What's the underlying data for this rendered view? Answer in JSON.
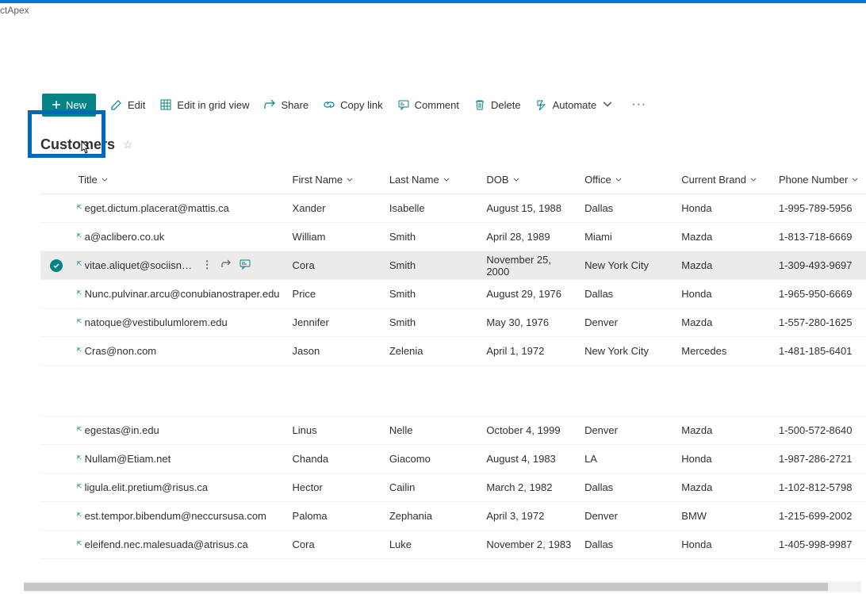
{
  "breadcrumb": "ctApex",
  "toolbar": {
    "new_label": "New",
    "edit_label": "Edit",
    "edit_grid_label": "Edit in grid view",
    "share_label": "Share",
    "copylink_label": "Copy link",
    "comment_label": "Comment",
    "delete_label": "Delete",
    "automate_label": "Automate"
  },
  "list_title": "Customers",
  "columns": {
    "title": "Title",
    "first_name": "First Name",
    "last_name": "Last Name",
    "dob": "DOB",
    "office": "Office",
    "brand": "Current Brand",
    "phone": "Phone Number"
  },
  "rows": [
    {
      "title": "eget.dictum.placerat@mattis.ca",
      "first": "Xander",
      "last": "Isabelle",
      "dob": "August 15, 1988",
      "office": "Dallas",
      "brand": "Honda",
      "phone": "1-995-789-5956"
    },
    {
      "title": "a@aclibero.co.uk",
      "first": "William",
      "last": "Smith",
      "dob": "April 28, 1989",
      "office": "Miami",
      "brand": "Mazda",
      "phone": "1-813-718-6669"
    },
    {
      "title": "vitae.aliquet@sociisnato...",
      "first": "Cora",
      "last": "Smith",
      "dob": "November 25, 2000",
      "office": "New York City",
      "brand": "Mazda",
      "phone": "1-309-493-9697",
      "selected": true
    },
    {
      "title": "Nunc.pulvinar.arcu@conubianostraper.edu",
      "first": "Price",
      "last": "Smith",
      "dob": "August 29, 1976",
      "office": "Dallas",
      "brand": "Honda",
      "phone": "1-965-950-6669"
    },
    {
      "title": "natoque@vestibulumlorem.edu",
      "first": "Jennifer",
      "last": "Smith",
      "dob": "May 30, 1976",
      "office": "Denver",
      "brand": "Mazda",
      "phone": "1-557-280-1625"
    },
    {
      "title": "Cras@non.com",
      "first": "Jason",
      "last": "Zelenia",
      "dob": "April 1, 1972",
      "office": "New York City",
      "brand": "Mercedes",
      "phone": "1-481-185-6401"
    },
    {
      "title": "egestas@in.edu",
      "first": "Linus",
      "last": "Nelle",
      "dob": "October 4, 1999",
      "office": "Denver",
      "brand": "Mazda",
      "phone": "1-500-572-8640"
    },
    {
      "title": "Nullam@Etiam.net",
      "first": "Chanda",
      "last": "Giacomo",
      "dob": "August 4, 1983",
      "office": "LA",
      "brand": "Honda",
      "phone": "1-987-286-2721"
    },
    {
      "title": "ligula.elit.pretium@risus.ca",
      "first": "Hector",
      "last": "Cailin",
      "dob": "March 2, 1982",
      "office": "Dallas",
      "brand": "Mazda",
      "phone": "1-102-812-5798"
    },
    {
      "title": "est.tempor.bibendum@neccursusa.com",
      "first": "Paloma",
      "last": "Zephania",
      "dob": "April 3, 1972",
      "office": "Denver",
      "brand": "BMW",
      "phone": "1-215-699-2002"
    },
    {
      "title": "eleifend.nec.malesuada@atrisus.ca",
      "first": "Cora",
      "last": "Luke",
      "dob": "November 2, 1983",
      "office": "Dallas",
      "brand": "Honda",
      "phone": "1-405-998-9987"
    }
  ]
}
